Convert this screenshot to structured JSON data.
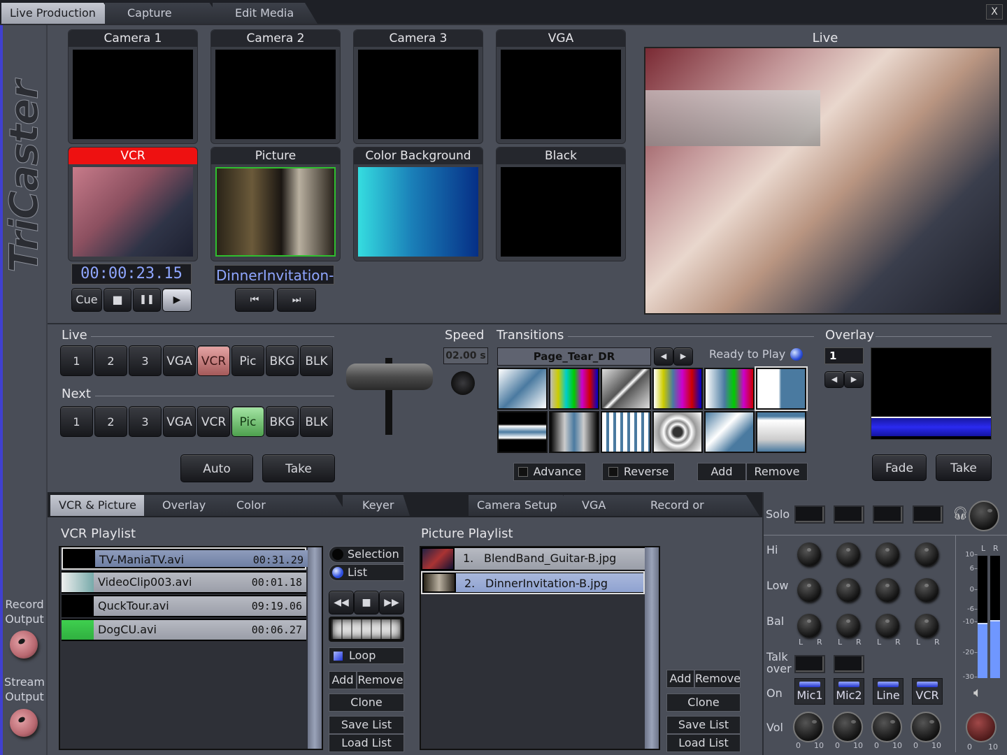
{
  "window": {
    "close_label": "X"
  },
  "top_tabs": [
    {
      "label": "Live Production",
      "active": true
    },
    {
      "label": "Capture Media",
      "active": false
    },
    {
      "label": "Edit Media",
      "active": false
    }
  ],
  "brand": {
    "logo": "TriCaster"
  },
  "side": {
    "record_label_1": "Record",
    "record_label_2": "Output",
    "stream_label_1": "Stream",
    "stream_label_2": "Output"
  },
  "monitors": {
    "row1": [
      {
        "title": "Camera 1"
      },
      {
        "title": "Camera 2"
      },
      {
        "title": "Camera 3"
      },
      {
        "title": "VGA"
      }
    ],
    "row2": [
      {
        "title": "VCR",
        "state": "live"
      },
      {
        "title": "Picture",
        "state": "next"
      },
      {
        "title": "Color Background"
      },
      {
        "title": "Black"
      }
    ],
    "live_title": "Live"
  },
  "vcr": {
    "timecode": "00:00:23.15",
    "buttons": {
      "cue": "Cue",
      "stop": "■",
      "pause": "❚❚",
      "play": "▶"
    }
  },
  "picture": {
    "filename": "DinnerInvitation-B",
    "prev": "⏮",
    "next": "⏭"
  },
  "switcher": {
    "live_label": "Live",
    "next_label": "Next",
    "live_buttons": [
      "1",
      "2",
      "3",
      "VGA",
      "VCR",
      "Pic",
      "BKG",
      "BLK"
    ],
    "live_active": "VCR",
    "next_buttons": [
      "1",
      "2",
      "3",
      "VGA",
      "VCR",
      "Pic",
      "BKG",
      "BLK"
    ],
    "next_active": "Pic",
    "auto_label": "Auto",
    "take_label": "Take"
  },
  "speed": {
    "label": "Speed",
    "value": "02.00 s"
  },
  "transitions": {
    "label": "Transitions",
    "current": "Page_Tear_DR",
    "status": "Ready to Play",
    "thumbnails": [
      "Fade",
      "Color Bars",
      "Diagonal Wipe",
      "Bars Slice",
      "Bars Curl",
      "Page Tear DR",
      "Spin Horizontal",
      "Spin Vertical",
      "Blinds",
      "Ripple",
      "Page Curl",
      "Dissolve Box"
    ],
    "selected_index": 5,
    "advance_label": "Advance",
    "reverse_label": "Reverse",
    "add_label": "Add",
    "remove_label": "Remove"
  },
  "overlay": {
    "label": "Overlay",
    "index": "1",
    "fade_label": "Fade",
    "take_label": "Take"
  },
  "bottom_tabs": [
    {
      "label": "VCR & Picture",
      "active": true
    },
    {
      "label": "Overlay",
      "active": false
    },
    {
      "label": "Color Background",
      "active": false
    },
    {
      "label": "Keyer",
      "active": false
    },
    {
      "label": "Camera Setup",
      "active": false
    },
    {
      "label": "VGA",
      "active": false
    },
    {
      "label": "Record or Stream",
      "active": false
    }
  ],
  "vcr_playlist": {
    "title": "VCR Playlist",
    "items": [
      {
        "name": "TV-ManiaTV.avi",
        "duration": "00:31.29",
        "selected": true
      },
      {
        "name": "VideoClip003.avi",
        "duration": "00:01.18"
      },
      {
        "name": "QuckTour.avi",
        "duration": "09:19.06"
      },
      {
        "name": "DogCU.avi",
        "duration": "00:06.27"
      }
    ],
    "mode_selection": "Selection",
    "mode_list": "List",
    "mode_selected": "List",
    "loop_label": "Loop",
    "loop_checked": true,
    "add_label": "Add",
    "remove_label": "Remove",
    "clone_label": "Clone",
    "save_label": "Save List",
    "load_label": "Load List"
  },
  "picture_playlist": {
    "title": "Picture Playlist",
    "items": [
      {
        "num": "1.",
        "name": "BlendBand_Guitar-B.jpg"
      },
      {
        "num": "2.",
        "name": "DinnerInvitation-B.jpg",
        "selected": true
      }
    ],
    "add_label": "Add",
    "remove_label": "Remove",
    "clone_label": "Clone",
    "save_label": "Save List",
    "load_label": "Load List"
  },
  "audio": {
    "solo_label": "Solo",
    "hi_label": "Hi",
    "low_label": "Low",
    "bal_label": "Bal",
    "talk_label_1": "Talk",
    "talk_label_2": "over",
    "on_label": "On",
    "vol_label": "Vol",
    "l": "L",
    "r": "R",
    "channels": [
      "Mic1",
      "Mic2",
      "Line",
      "VCR"
    ],
    "vol_min": "0",
    "vol_max": "10",
    "meter_ticks": [
      "10",
      "6",
      "0",
      "-6",
      "-10",
      "-20",
      "-30"
    ],
    "meter_level_l_db": -10,
    "meter_level_r_db": -9,
    "meter_color": "#6f97ff"
  }
}
